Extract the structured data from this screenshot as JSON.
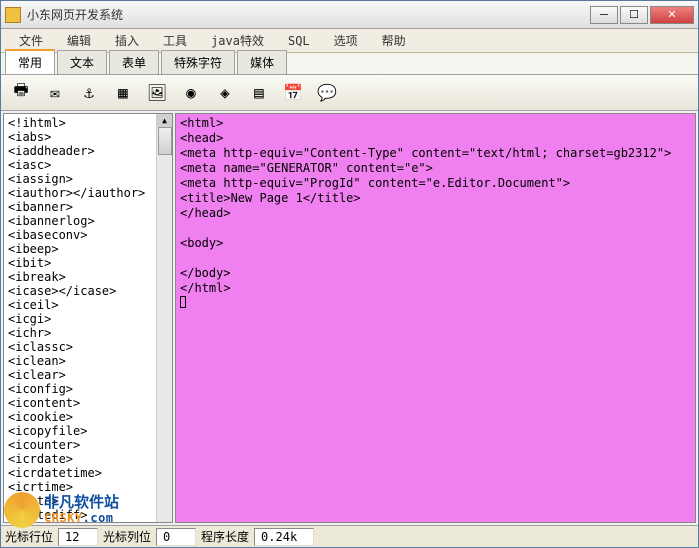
{
  "window": {
    "title": "小东网页开发系统"
  },
  "menu": {
    "file": "文件",
    "edit": "编辑",
    "insert": "插入",
    "tools": "工具",
    "java": "java特效",
    "sql": "SQL",
    "options": "选项",
    "help": "帮助"
  },
  "tabs": {
    "common": "常用",
    "text": "文本",
    "form": "表单",
    "special": "特殊字符",
    "media": "媒体"
  },
  "sidebar": {
    "items": [
      "<!ihtml>",
      "<iabs>",
      "<iaddheader>",
      "<iasc>",
      "<iassign>",
      "<iauthor></iauthor>",
      "<ibanner>",
      "<ibannerlog>",
      "<ibaseconv>",
      "<ibeep>",
      "<ibit>",
      "<ibreak>",
      "<icase></icase>",
      "<iceil>",
      "<icgi>",
      "<ichr>",
      "<iclassc>",
      "<iclean>",
      "<iclear>",
      "<iconfig>",
      "<icontent>",
      "<icookie>",
      "<icopyfile>",
      "<icounter>",
      "<icrdate>",
      "<icrdatetime>",
      "<icrtime>",
      "<idate>",
      "<idatediff>"
    ]
  },
  "editor": {
    "lines": [
      "<html>",
      "<head>",
      "<meta http-equiv=\"Content-Type\" content=\"text/html; charset=gb2312\">",
      "<meta name=\"GENERATOR\" content=\"e\">",
      "<meta http-equiv=\"ProgId\" content=\"e.Editor.Document\">",
      "<title>New Page 1</title>",
      "</head>",
      "",
      "<body>",
      "",
      "</body>",
      "</html>"
    ]
  },
  "status": {
    "line_label": "光标行位",
    "line_value": "12",
    "col_label": "光标列位",
    "col_value": "0",
    "len_label": "程序长度",
    "len_value": "0.24k"
  },
  "watermark": {
    "cn": "非凡软件站",
    "en1": "CRSKY",
    "en2": ".com"
  }
}
